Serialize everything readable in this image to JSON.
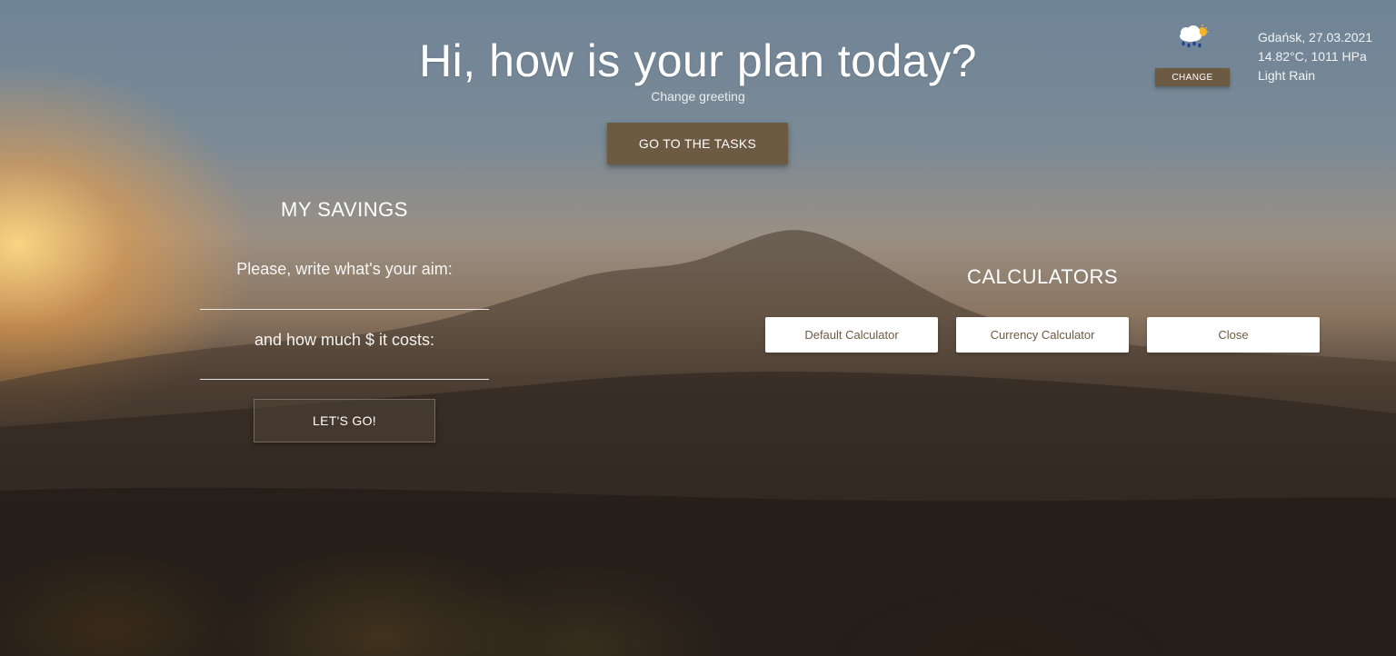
{
  "greeting": {
    "title": "Hi, how is your plan today?",
    "change_label": "Change greeting"
  },
  "tasks_button": "GO TO THE TASKS",
  "weather": {
    "icon": "rain-cloud-sun-icon",
    "change_label": "CHANGE",
    "location_date": "Gdańsk, 27.03.2021",
    "temp_pressure": "14.82°C, 1011 HPa",
    "description": "Light Rain"
  },
  "savings": {
    "title": "MY SAVINGS",
    "aim_label": "Please, write what's your aim:",
    "aim_value": "",
    "cost_label": "and how much $ it costs:",
    "cost_value": "",
    "submit_label": "LET'S GO!"
  },
  "calculators": {
    "title": "CALCULATORS",
    "buttons": [
      "Default Calculator",
      "Currency Calculator",
      "Close"
    ]
  },
  "colors": {
    "accent": "#6d5a43",
    "button_text": "#6d5a43"
  }
}
